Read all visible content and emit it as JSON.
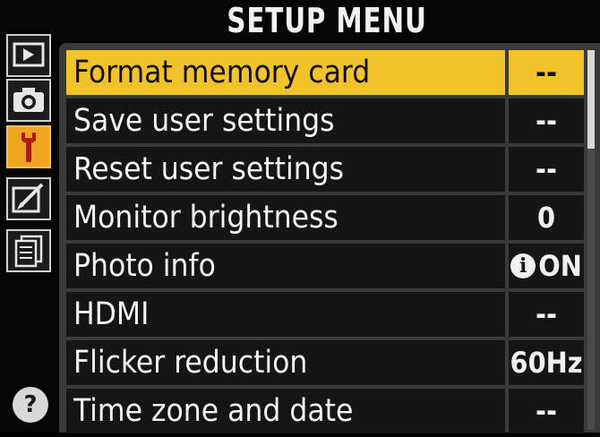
{
  "title": "SETUP MENU",
  "accent_color": "#f2c22a",
  "tab_active_color": "#f0a51e",
  "tabs": [
    {
      "name": "playback",
      "icon": "playback-icon"
    },
    {
      "name": "shooting",
      "icon": "camera-icon"
    },
    {
      "name": "setup",
      "icon": "wrench-icon",
      "active": true
    },
    {
      "name": "retouch",
      "icon": "retouch-brush-icon"
    },
    {
      "name": "recent",
      "icon": "recent-settings-icon"
    }
  ],
  "help_label": "?",
  "items": [
    {
      "label": "Format memory card",
      "value": "--",
      "selected": true
    },
    {
      "label": "Save user settings",
      "value": "--"
    },
    {
      "label": "Reset user settings",
      "value": "--"
    },
    {
      "label": "Monitor brightness",
      "value": "0"
    },
    {
      "label": "Photo info",
      "value": "ON",
      "value_icon": "info-icon",
      "value_icon_text": "i"
    },
    {
      "label": "HDMI",
      "value": "--"
    },
    {
      "label": "Flicker reduction",
      "value": "60Hz"
    },
    {
      "label": "Time zone and date",
      "value": "--"
    }
  ],
  "scroll": {
    "position": 0,
    "visible_fraction": 0.26
  }
}
